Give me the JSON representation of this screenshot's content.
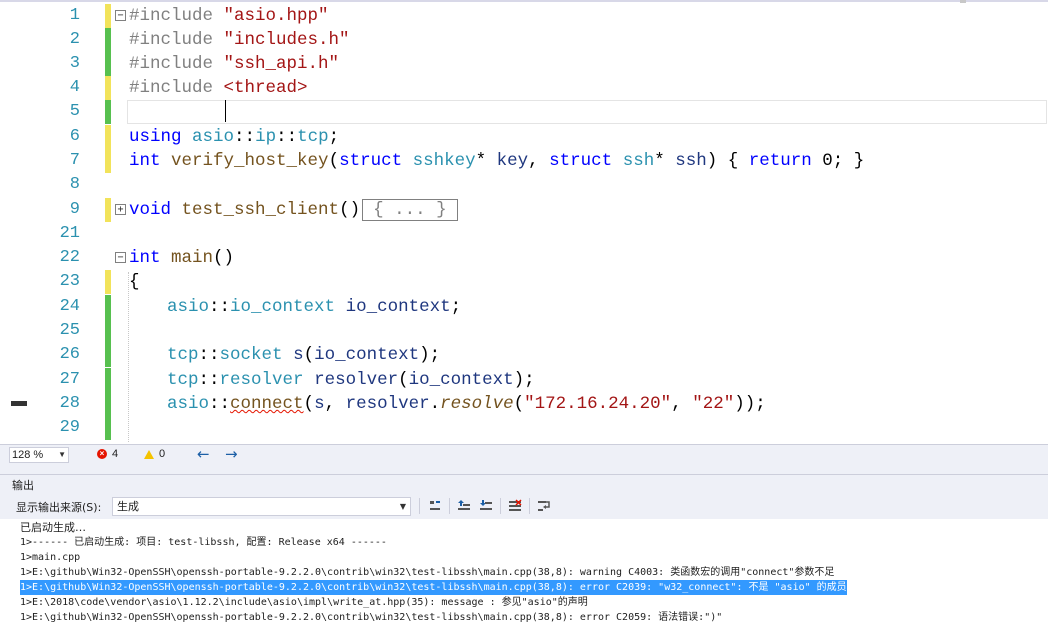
{
  "editor": {
    "lines": [
      {
        "num": "1",
        "change": "yellow",
        "fold": "minus",
        "code": "#include \"asio.hpp\""
      },
      {
        "num": "2",
        "change": "green",
        "code": "#include \"includes.h\""
      },
      {
        "num": "3",
        "change": "green",
        "code": "#include \"ssh_api.h\""
      },
      {
        "num": "4",
        "change": "yellow",
        "code": "#include <thread>"
      },
      {
        "num": "5",
        "change": "green",
        "code": ""
      },
      {
        "num": "6",
        "change": "yellow",
        "code": "using asio::ip::tcp;"
      },
      {
        "num": "7",
        "change": "yellow",
        "code": "int verify_host_key(struct sshkey* key, struct ssh* ssh) { return 0; }"
      },
      {
        "num": "8",
        "change": "",
        "code": ""
      },
      {
        "num": "9",
        "change": "yellow",
        "fold": "plus",
        "code": "void test_ssh_client()",
        "collapsed": "{ ... }"
      },
      {
        "num": "21",
        "change": "",
        "code": ""
      },
      {
        "num": "22",
        "change": "",
        "fold": "minus",
        "code": "int main()"
      },
      {
        "num": "23",
        "change": "yellow",
        "code": "{"
      },
      {
        "num": "24",
        "change": "green",
        "code": "asio::io_context io_context;"
      },
      {
        "num": "25",
        "change": "green",
        "code": ""
      },
      {
        "num": "26",
        "change": "green",
        "code": "tcp::socket s(io_context);"
      },
      {
        "num": "27",
        "change": "green",
        "code": "tcp::resolver resolver(io_context);"
      },
      {
        "num": "28",
        "change": "green",
        "code": "asio::connect(s, resolver.resolve(\"172.16.24.20\", \"22\"));"
      },
      {
        "num": "29",
        "change": "green",
        "code": ""
      }
    ],
    "colors": {
      "change_yellow": "#f2e35a",
      "change_green": "#57c04f",
      "line_number": "#2b91af",
      "keyword": "#0000ff",
      "string": "#a31515"
    }
  },
  "status": {
    "zoom": "128 %",
    "errors": "4",
    "warnings": "0",
    "back_icon": "arrow-left-icon",
    "forward_icon": "arrow-right-icon"
  },
  "output": {
    "title": "输出",
    "source_label": "显示输出来源(S):",
    "source_value": "生成",
    "toolbar_icons": [
      "find-message-icon",
      "prev-message-icon",
      "next-message-icon",
      "clear-all-icon",
      "word-wrap-icon"
    ],
    "lines": [
      "已启动生成…",
      "1>------ 已启动生成: 项目: test-libssh, 配置: Release x64 ------",
      "1>main.cpp",
      "1>E:\\github\\Win32-OpenSSH\\openssh-portable-9.2.2.0\\contrib\\win32\\test-libssh\\main.cpp(38,8): warning C4003: 类函数宏的调用\"connect\"参数不足",
      "1>E:\\github\\Win32-OpenSSH\\openssh-portable-9.2.2.0\\contrib\\win32\\test-libssh\\main.cpp(38,8): error C2039: \"w32_connect\": 不是 \"asio\" 的成员",
      "1>E:\\2018\\code\\vendor\\asio\\1.12.2\\include\\asio\\impl\\write_at.hpp(35): message : 参见\"asio\"的声明",
      "1>E:\\github\\Win32-OpenSSH\\openssh-portable-9.2.2.0\\contrib\\win32\\test-libssh\\main.cpp(38,8): error C2059: 语法错误:\")\""
    ],
    "selected_line": 4
  }
}
